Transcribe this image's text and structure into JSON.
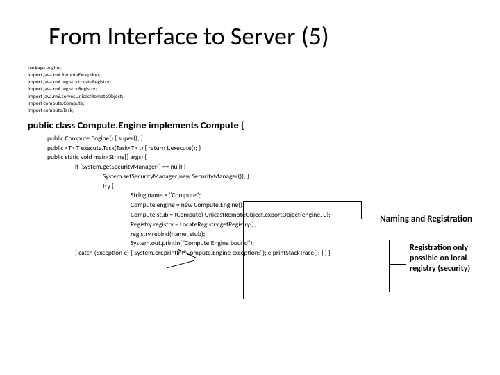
{
  "title": "From Interface to Server (5)",
  "imports": [
    "package engine;",
    "import java.rmi.RemoteException;",
    "import java.rmi.registry.LocateRegistry;",
    "import java.rmi.registry.Registry;",
    "import java.rmi.server.UnicastRemoteObject;",
    "import compute.Compute;",
    "import compute.Task;"
  ],
  "classdecl": "public class Compute.Engine implements Compute {",
  "code": {
    "c1": "public Compute.Engine() {  super(); }",
    "c2": "public <T> T execute.Task(Task<T> t) { return t.execute(); }",
    "c3": "public static void main(String[] args) {",
    "c4": "if (System.getSecurityManager() == null) {",
    "c5": "System.setSecurityManager(new SecurityManager()); }",
    "c6": "try {",
    "c7": "String name = \"Compute\";",
    "c8": "Compute engine = new Compute.Engine();",
    "c9": "Compute stub = (Compute) UnicastRemoteObject.exportObject(engine, 0);",
    "c10": "Registry registry = LocateRegistry.getRegistry();",
    "c11": "registry.rebind(name, stub);",
    "c12": "System.out.println(\"Compute.Engine bound\");",
    "c13": "} catch (Exception e) { System.err.println(\"Compute.Engine exception:\"); e.printStackTrace(); } } }"
  },
  "annot1": "Naming and Registration",
  "annot2": "Registration only possible on local registry (security)"
}
